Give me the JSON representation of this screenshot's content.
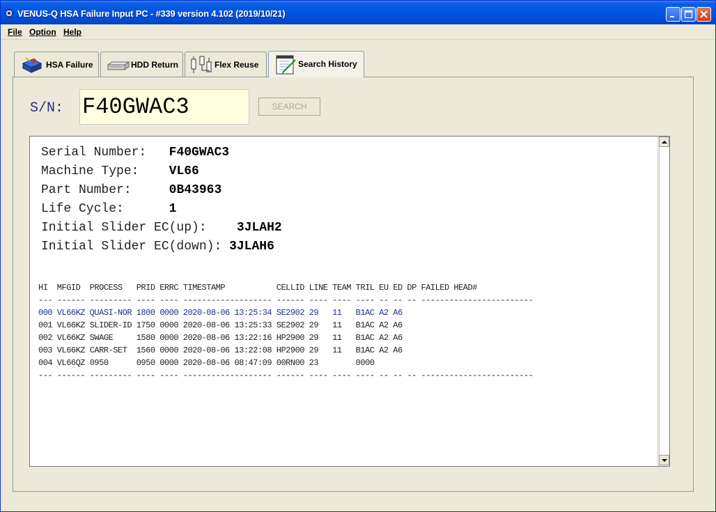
{
  "window": {
    "title": "VENUS-Q HSA Failure Input PC - #339 version 4.102 (2019/10/21)",
    "icon": "gear-app-icon"
  },
  "menu": [
    {
      "label": "File"
    },
    {
      "label": "Option"
    },
    {
      "label": "Help"
    }
  ],
  "tabs": [
    {
      "label": "HSA Failure",
      "icon": "hsa-icon",
      "selected": false
    },
    {
      "label": "HDD Return",
      "icon": "hdd-icon",
      "selected": false
    },
    {
      "label": "Flex Reuse",
      "icon": "flex-icon",
      "selected": false
    },
    {
      "label": "Search History",
      "icon": "notepad-icon",
      "selected": true
    }
  ],
  "search": {
    "label": "S/N:",
    "value": "F40GWAC3",
    "button_label": "SEARCH",
    "button_enabled": false
  },
  "info": [
    {
      "label": "Serial Number:",
      "value": "F40GWAC3"
    },
    {
      "label": "Machine Type:",
      "value": "VL66"
    },
    {
      "label": "Part Number:",
      "value": "0B43963"
    },
    {
      "label": "Life Cycle:",
      "value": "1"
    },
    {
      "label": "Initial Slider EC(up):",
      "value": "3JLAH2"
    },
    {
      "label": "Initial Slider EC(down):",
      "value": "3JLAH6"
    }
  ],
  "history_table": {
    "header": "HI  MFGID  PROCESS   PRID ERRC TIMESTAMP           CELLID LINE TEAM TRIL EU ED DP FAILED HEAD#",
    "separator": "--- ------ --------- ---- ---- ------------------- ------ ---- ---- ---- -- -- -- ------------------------",
    "rows": [
      "000 VL66KZ QUASI-NOR 1800 0000 2020-08-06 13:25:34 SE2902 29   11   B1AC A2 A6",
      "001 VL66KZ SLIDER-ID 1750 0000 2020-08-06 13:25:33 SE2902 29   11   B1AC A2 A6",
      "002 VL66KZ SWAGE     1580 0000 2020-08-06 13:22:16 HP2900 29   11   B1AC A2 A6",
      "003 VL66KZ CARR-SET  1560 0000 2020-08-06 13:22:08 HP2900 29   11   B1AC A2 A6",
      "004 VL66QZ 0950      0950 0000 2020-08-06 08:47:09 00RN00 23        0000"
    ],
    "selected_row": 0
  },
  "colors": {
    "titlebar": "#0055e5",
    "sn_field_bg": "#ffffe0",
    "selected_row_text": "#1a2f9a",
    "sn_label": "#2a2a8a"
  }
}
